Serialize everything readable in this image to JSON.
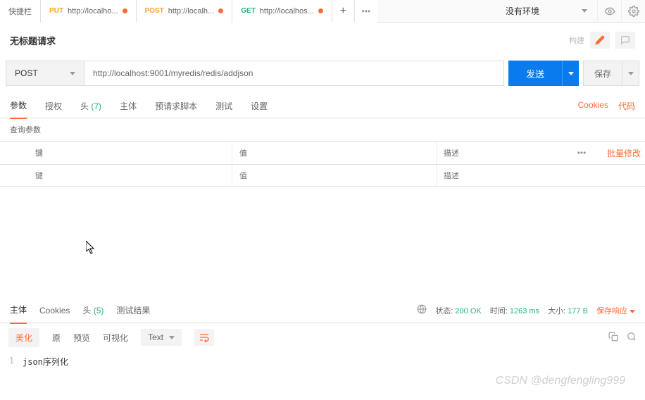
{
  "top": {
    "quickbar": "快捷栏",
    "tabs": [
      {
        "method": "PUT",
        "label": "http://localho..."
      },
      {
        "method": "POST",
        "label": "http://localh..."
      },
      {
        "method": "GET",
        "label": "http://localhos..."
      }
    ],
    "env": "没有环境"
  },
  "title": {
    "text": "无标题请求",
    "build": "构建"
  },
  "request": {
    "method": "POST",
    "url": "http://localhost:9001/myredis/redis/addjson",
    "send": "发送",
    "save": "保存"
  },
  "reqTabs": {
    "params": "参数",
    "auth": "授权",
    "headers": "头",
    "headersCount": "(7)",
    "body": "主体",
    "prescript": "预请求脚本",
    "tests": "测试",
    "settings": "设置",
    "cookies": "Cookies",
    "code": "代码"
  },
  "params": {
    "section": "查询参数",
    "keyHeader": "键",
    "valHeader": "值",
    "descHeader": "描述",
    "bulkEdit": "批量修改",
    "keyPH": "键",
    "valPH": "值",
    "descPH": "描述"
  },
  "response": {
    "tabs": {
      "body": "主体",
      "cookies": "Cookies",
      "headers": "头",
      "headersCount": "(5)",
      "tests": "测试结果"
    },
    "status": {
      "statusLabel": "状态:",
      "statusValue": "200 OK",
      "timeLabel": "时间:",
      "timeValue": "1263 ms",
      "sizeLabel": "大小:",
      "sizeValue": "177 B",
      "saveResp": "保存响应"
    },
    "toolbar": {
      "beautify": "美化",
      "raw": "原",
      "preview": "预览",
      "visualize": "可视化",
      "format": "Text"
    },
    "body": {
      "line1": "json序列化"
    }
  },
  "watermark": "CSDN @dengfengling999"
}
